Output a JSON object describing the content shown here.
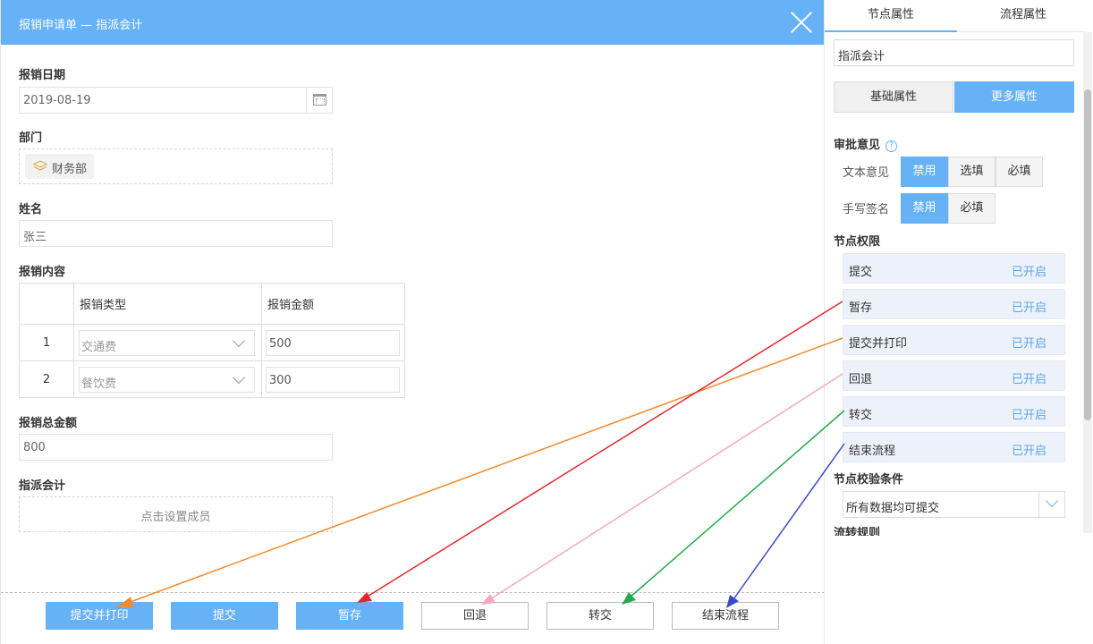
{
  "form": {
    "title": "报销申请单 — 指派会计",
    "fields": {
      "date_label": "报销日期",
      "date_value": "2019-08-19",
      "dept_label": "部门",
      "dept_value": "财务部",
      "name_label": "姓名",
      "name_value": "张三",
      "content_label": "报销内容",
      "total_label": "报销总金额",
      "total_value": "800",
      "assign_label": "指派会计",
      "assign_placeholder": "点击设置成员"
    },
    "table": {
      "headers": [
        "",
        "报销类型",
        "报销金额"
      ],
      "rows": [
        {
          "no": "1",
          "type": "交通费",
          "amount": "500"
        },
        {
          "no": "2",
          "type": "餐饮费",
          "amount": "300"
        }
      ]
    },
    "buttons": {
      "submit_print": "提交并打印",
      "submit": "提交",
      "save": "暂存",
      "return": "回退",
      "transfer": "转交",
      "end": "结束流程"
    }
  },
  "props": {
    "tabs": [
      "节点属性",
      "流程属性"
    ],
    "node_name": "指派会计",
    "seg": [
      "基础属性",
      "更多属性"
    ],
    "approval_label": "审批意见",
    "text_opinion_label": "文本意见",
    "text_opinion_opts": [
      "禁用",
      "选填",
      "必填"
    ],
    "sign_label": "手写签名",
    "sign_opts": [
      "禁用",
      "必填"
    ],
    "perm_label": "节点权限",
    "perms": [
      {
        "label": "提交",
        "status": "已开启"
      },
      {
        "label": "暂存",
        "status": "已开启"
      },
      {
        "label": "提交并打印",
        "status": "已开启"
      },
      {
        "label": "回退",
        "status": "已开启"
      },
      {
        "label": "转交",
        "status": "已开启"
      },
      {
        "label": "结束流程",
        "status": "已开启"
      }
    ],
    "check_label": "节点校验条件",
    "check_value": "所有数据均可提交",
    "flow_label": "流转规则"
  },
  "colors": {
    "accent": "#67b1f6",
    "arrow_submit_print": "#f08a2c",
    "arrow_save": "#e0282e",
    "arrow_return": "#f4a7c3",
    "arrow_transfer": "#22aa4a",
    "arrow_end": "#3b4bc8"
  }
}
